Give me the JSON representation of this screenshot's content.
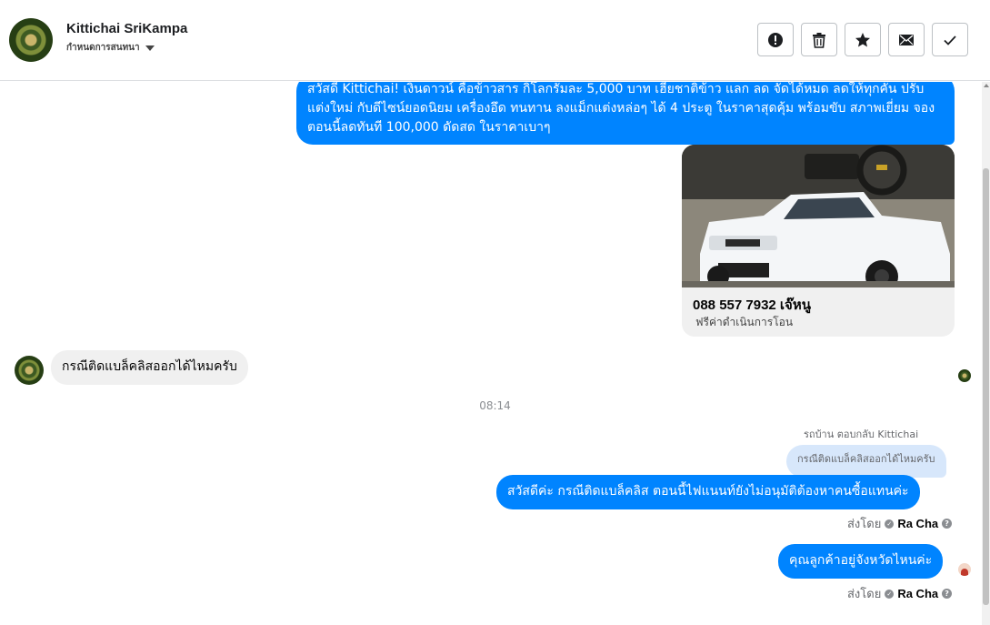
{
  "header": {
    "contact_name": "Kittichai SriKampa",
    "contact_status": "กำหนดการสนทนา",
    "actions": [
      {
        "icon": "alert-icon",
        "name": "mark-spam-button"
      },
      {
        "icon": "trash-icon",
        "name": "delete-button"
      },
      {
        "icon": "star-icon",
        "name": "star-button"
      },
      {
        "icon": "envelope-icon",
        "name": "mark-unread-button"
      },
      {
        "icon": "checkmark-icon",
        "name": "mark-done-button"
      }
    ]
  },
  "thread": {
    "message_1": "สวัสดี Kittichai! เงินดาวน์ คือข้าวสาร กิโลกรัมละ 5,000 บาท เฮียชาติข้าว แลก ลด จัดได้หมด ลดให้ทุกคัน ปรับแต่งใหม่ กับดีไซน์ยอดนิยม เครื่องอึด ทนทาน ลงแม็กแต่งหล่อๆ ได้ 4 ประตู ในราคาสุดคุ้ม พร้อมขับ สภาพเยี่ยม จองตอนนี้ลดทันที 100,000 ดัดสด ในราคาเบาๆ",
    "card": {
      "title": "088 557 7932 เจ๊หนู",
      "subtitle": "ฟรีค่าดำเนินการโอน"
    },
    "message_2": "กรณีติดแบล็คลิสออกได้ไหมครับ",
    "timestamp": "08:14",
    "reply_label": "รถบ้าน ตอบกลับ Kittichai",
    "quoted_text": "กรณีติดแบล็คลิสออกได้ไหมครับ",
    "message_3": "สวัสดีค่ะ กรณีติดแบล็คลิส ตอนนี้ไฟแนนท์ยังไม่อนุมัติต้องหาคนซื้อแทนค่ะ",
    "sent_by_label": "ส่งโดย",
    "sent_by_name": "Ra Cha",
    "message_4": "คุณลูกค้าอยู่จังหวัดไหนค่ะ"
  },
  "colors": {
    "outgoing_bubble": "#0084ff",
    "incoming_bubble": "#f0f0f0",
    "quoted_bubble": "#d7e7fb"
  }
}
